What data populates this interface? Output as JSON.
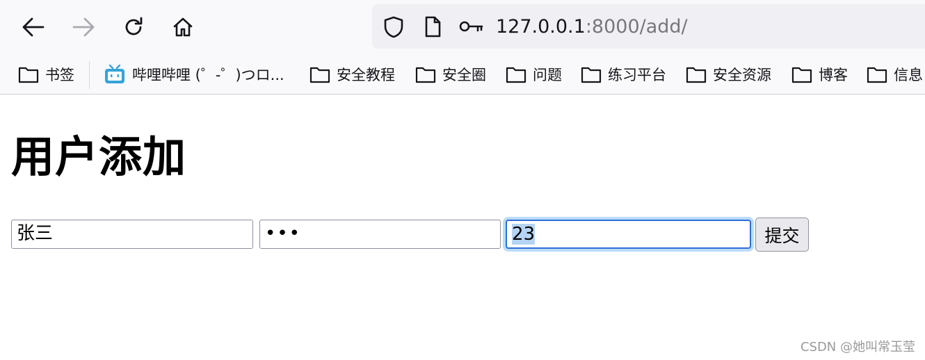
{
  "browser": {
    "url_host": "127.0.0.1",
    "url_rest": ":8000/add/",
    "nav_icons": [
      "back-arrow-icon",
      "forward-arrow-icon",
      "reload-icon",
      "home-icon"
    ],
    "urlbar_icons": [
      "shield-icon",
      "page-icon",
      "key-icon"
    ]
  },
  "bookmarks": [
    {
      "label": "书签",
      "icon": "folder-icon"
    },
    {
      "label": "哔哩哔哩 (゜-゜)つロ...",
      "icon": "bilibili-icon"
    },
    {
      "label": "安全教程",
      "icon": "folder-icon"
    },
    {
      "label": "安全圈",
      "icon": "folder-icon"
    },
    {
      "label": "问题",
      "icon": "folder-icon"
    },
    {
      "label": "练习平台",
      "icon": "folder-icon"
    },
    {
      "label": "安全资源",
      "icon": "folder-icon"
    },
    {
      "label": "博客",
      "icon": "folder-icon"
    },
    {
      "label": "信息",
      "icon": "folder-icon"
    }
  ],
  "page": {
    "title": "用户添加",
    "form": {
      "name_value": "张三",
      "password_masked": "•••",
      "age_value": "23",
      "submit_label": "提交"
    }
  },
  "watermark": "CSDN @她叫常玉莹",
  "colors": {
    "focus_border": "#2e6ed6",
    "focus_ring": "#bcdcf8",
    "selection": "#b5d4f4",
    "bilibili": "#36a3d9"
  }
}
